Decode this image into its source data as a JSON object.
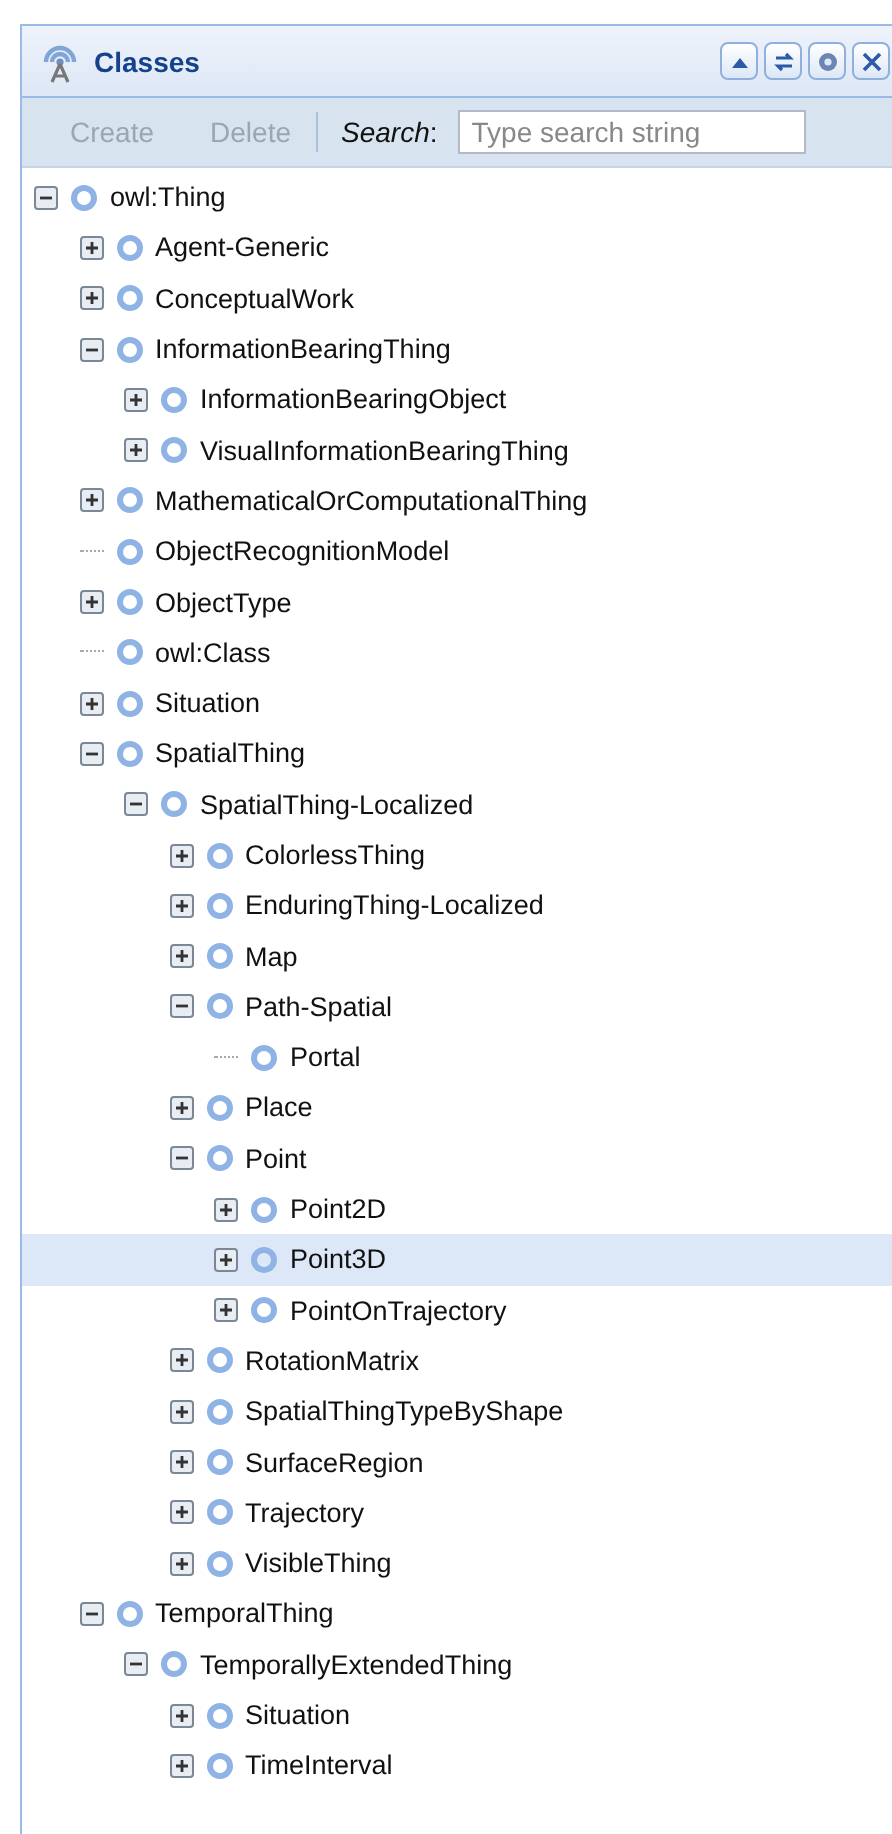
{
  "panel": {
    "title": "Classes",
    "header_tools": [
      {
        "kind": "collapse"
      },
      {
        "kind": "refresh"
      },
      {
        "kind": "settings"
      },
      {
        "kind": "close"
      }
    ]
  },
  "toolbar": {
    "buttons": [
      {
        "label": "Create",
        "disabled": true
      },
      {
        "label": "Delete",
        "disabled": true
      }
    ],
    "search_label": "*Search*:",
    "search": {
      "placeholder": "Type search string"
    }
  },
  "tree": [
    {
      "label": "owl:Thing",
      "kind": "branch",
      "expanded": true,
      "selected": false,
      "children": [
        {
          "label": "Agent-Generic",
          "kind": "branch",
          "expanded": false,
          "selected": false
        },
        {
          "label": "ConceptualWork",
          "kind": "branch",
          "expanded": false,
          "selected": false
        },
        {
          "label": "InformationBearingThing",
          "kind": "branch",
          "expanded": true,
          "selected": false,
          "children": [
            {
              "label": "InformationBearingObject",
              "kind": "branch",
              "expanded": false,
              "selected": false
            },
            {
              "label": "VisualInformationBearingThing",
              "kind": "branch",
              "expanded": false,
              "selected": false
            }
          ]
        },
        {
          "label": "MathematicalOrComputationalThing",
          "kind": "branch",
          "expanded": false,
          "selected": false
        },
        {
          "label": "ObjectRecognitionModel",
          "kind": "leaf",
          "selected": false
        },
        {
          "label": "ObjectType",
          "kind": "branch",
          "expanded": false,
          "selected": false
        },
        {
          "label": "owl:Class",
          "kind": "leaf",
          "selected": false
        },
        {
          "label": "Situation",
          "kind": "branch",
          "expanded": false,
          "selected": false
        },
        {
          "label": "SpatialThing",
          "kind": "branch",
          "expanded": true,
          "selected": false,
          "children": [
            {
              "label": "SpatialThing-Localized",
              "kind": "branch",
              "expanded": true,
              "selected": false,
              "children": [
                {
                  "label": "ColorlessThing",
                  "kind": "branch",
                  "expanded": false,
                  "selected": false
                },
                {
                  "label": "EnduringThing-Localized",
                  "kind": "branch",
                  "expanded": false,
                  "selected": false
                },
                {
                  "label": "Map",
                  "kind": "branch",
                  "expanded": false,
                  "selected": false
                },
                {
                  "label": "Path-Spatial",
                  "kind": "branch",
                  "expanded": true,
                  "selected": false,
                  "children": [
                    {
                      "label": "Portal",
                      "kind": "leaf",
                      "selected": false
                    }
                  ]
                },
                {
                  "label": "Place",
                  "kind": "branch",
                  "expanded": false,
                  "selected": false
                },
                {
                  "label": "Point",
                  "kind": "branch",
                  "expanded": true,
                  "selected": false,
                  "children": [
                    {
                      "label": "Point2D",
                      "kind": "branch",
                      "expanded": false,
                      "selected": false
                    },
                    {
                      "label": "Point3D",
                      "kind": "branch",
                      "expanded": false,
                      "selected": true
                    },
                    {
                      "label": "PointOnTrajectory",
                      "kind": "branch",
                      "expanded": false,
                      "selected": false
                    }
                  ]
                },
                {
                  "label": "RotationMatrix",
                  "kind": "branch",
                  "expanded": false,
                  "selected": false
                },
                {
                  "label": "SpatialThingTypeByShape",
                  "kind": "branch",
                  "expanded": false,
                  "selected": false
                },
                {
                  "label": "SurfaceRegion",
                  "kind": "branch",
                  "expanded": false,
                  "selected": false
                },
                {
                  "label": "Trajectory",
                  "kind": "branch",
                  "expanded": false,
                  "selected": false
                },
                {
                  "label": "VisibleThing",
                  "kind": "branch",
                  "expanded": false,
                  "selected": false
                }
              ]
            }
          ]
        },
        {
          "label": "TemporalThing",
          "kind": "branch",
          "expanded": true,
          "selected": false,
          "children": [
            {
              "label": "TemporallyExtendedThing",
              "kind": "branch",
              "expanded": true,
              "selected": false,
              "children": [
                {
                  "label": "Situation",
                  "kind": "branch",
                  "expanded": false,
                  "selected": false
                },
                {
                  "label": "TimeInterval",
                  "kind": "branch",
                  "expanded": false,
                  "selected": false
                }
              ]
            }
          ]
        }
      ]
    }
  ]
}
